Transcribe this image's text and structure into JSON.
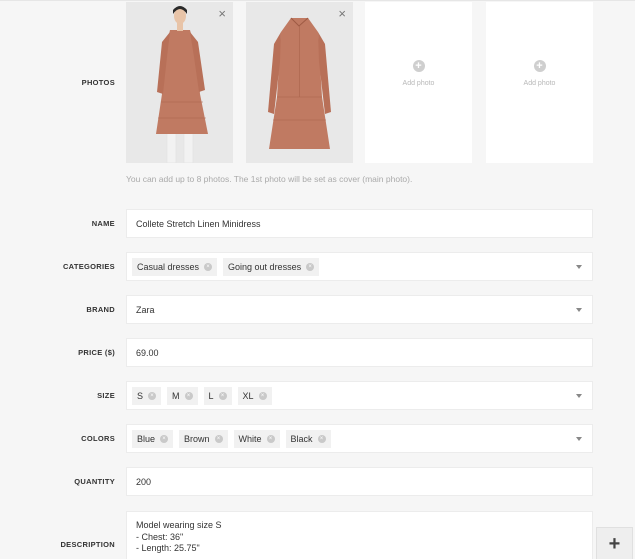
{
  "photos": {
    "label": "PHOTOS",
    "remove_icon": "×",
    "add_label": "Add photo",
    "hint": "You can add up to 8 photos. The 1st photo will be set as cover (main photo)."
  },
  "name": {
    "label": "NAME",
    "value": "Collete Stretch Linen Minidress"
  },
  "categories": {
    "label": "CATEGORIES",
    "chips": [
      "Casual dresses",
      "Going out dresses"
    ]
  },
  "brand": {
    "label": "BRAND",
    "value": "Zara"
  },
  "price": {
    "label": "PRICE ($)",
    "value": "69.00"
  },
  "size": {
    "label": "SIZE",
    "chips": [
      "S",
      "M",
      "L",
      "XL"
    ]
  },
  "colors": {
    "label": "COLORS",
    "chips": [
      "Blue",
      "Brown",
      "White",
      "Black"
    ]
  },
  "quantity": {
    "label": "QUANTITY",
    "value": "200"
  },
  "description": {
    "label": "DESCRIPTION",
    "lines": [
      "Model wearing size S",
      "- Chest: 36\"",
      "- Length: 25.75\""
    ]
  },
  "fab": {
    "icon": "plus-icon",
    "label": "+"
  },
  "colors_palette": {
    "dress": "#c07a62",
    "background": "#f6f6f6"
  }
}
